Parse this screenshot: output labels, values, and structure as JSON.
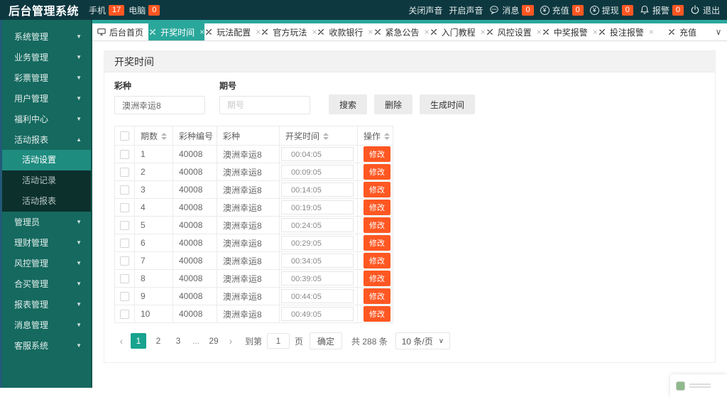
{
  "topbar": {
    "title": "后台管理系统",
    "mobile": {
      "label": "手机",
      "count": "17"
    },
    "pc": {
      "label": "电脑",
      "count": "0"
    },
    "sound_off_label": "关闭声音",
    "sound_on_label": "开启声音",
    "message": {
      "label": "消息",
      "count": "0"
    },
    "recharge": {
      "label": "充值",
      "count": "0"
    },
    "withdraw": {
      "label": "提现",
      "count": "0"
    },
    "alarm": {
      "label": "报警",
      "count": "0"
    },
    "logout_label": "退出"
  },
  "sidebar": {
    "items": [
      {
        "label": "系统管理",
        "state": "collapsed"
      },
      {
        "label": "业务管理",
        "state": "collapsed"
      },
      {
        "label": "彩票管理",
        "state": "collapsed"
      },
      {
        "label": "用户管理",
        "state": "collapsed"
      },
      {
        "label": "福利中心",
        "state": "collapsed"
      },
      {
        "label": "活动报表",
        "state": "expanded",
        "children": [
          {
            "label": "活动设置",
            "active": true
          },
          {
            "label": "活动记录",
            "active": false
          },
          {
            "label": "活动报表",
            "active": false
          }
        ]
      },
      {
        "label": "管理员",
        "state": "collapsed"
      },
      {
        "label": "理财管理",
        "state": "collapsed"
      },
      {
        "label": "风控管理",
        "state": "collapsed"
      },
      {
        "label": "合买管理",
        "state": "collapsed"
      },
      {
        "label": "报表管理",
        "state": "collapsed"
      },
      {
        "label": "消息管理",
        "state": "collapsed"
      },
      {
        "label": "客服系统",
        "state": "collapsed"
      }
    ]
  },
  "tabs": {
    "home_label": "后台首页",
    "items": [
      {
        "label": "开奖时间",
        "active": true,
        "closable": true
      },
      {
        "label": "玩法配置",
        "active": false,
        "closable": true
      },
      {
        "label": "官方玩法",
        "active": false,
        "closable": true
      },
      {
        "label": "收款银行",
        "active": false,
        "closable": true
      },
      {
        "label": "紧急公告",
        "active": false,
        "closable": true
      },
      {
        "label": "入门教程",
        "active": false,
        "closable": true
      },
      {
        "label": "风控设置",
        "active": false,
        "closable": true
      },
      {
        "label": "中奖报警",
        "active": false,
        "closable": true
      },
      {
        "label": "投注报警",
        "active": false,
        "closable": true
      },
      {
        "label": "充值",
        "active": false,
        "closable": false
      }
    ]
  },
  "panel": {
    "title": "开奖时间",
    "form": {
      "lottery_label": "彩种",
      "lottery_value": "澳洲幸运8",
      "issue_label": "期号",
      "issue_placeholder": "期号",
      "search_label": "搜索",
      "delete_label": "删除",
      "generate_label": "生成时间"
    },
    "table": {
      "headers": [
        {
          "label": "期数",
          "sortable": true
        },
        {
          "label": "彩种编号",
          "sortable": false
        },
        {
          "label": "彩种",
          "sortable": false
        },
        {
          "label": "开奖时间",
          "sortable": true
        },
        {
          "label": "操作",
          "sortable": true
        }
      ],
      "action_label": "修改",
      "rows": [
        {
          "no": "1",
          "code": "40008",
          "lottery": "澳洲幸运8",
          "time": "00:04:05"
        },
        {
          "no": "2",
          "code": "40008",
          "lottery": "澳洲幸运8",
          "time": "00:09:05"
        },
        {
          "no": "3",
          "code": "40008",
          "lottery": "澳洲幸运8",
          "time": "00:14:05"
        },
        {
          "no": "4",
          "code": "40008",
          "lottery": "澳洲幸运8",
          "time": "00:19:05"
        },
        {
          "no": "5",
          "code": "40008",
          "lottery": "澳洲幸运8",
          "time": "00:24:05"
        },
        {
          "no": "6",
          "code": "40008",
          "lottery": "澳洲幸运8",
          "time": "00:29:05"
        },
        {
          "no": "7",
          "code": "40008",
          "lottery": "澳洲幸运8",
          "time": "00:34:05"
        },
        {
          "no": "8",
          "code": "40008",
          "lottery": "澳洲幸运8",
          "time": "00:39:05"
        },
        {
          "no": "9",
          "code": "40008",
          "lottery": "澳洲幸运8",
          "time": "00:44:05"
        },
        {
          "no": "10",
          "code": "40008",
          "lottery": "澳洲幸运8",
          "time": "00:49:05"
        }
      ]
    },
    "pagination": {
      "pages": [
        "1",
        "2",
        "3",
        "...",
        "29"
      ],
      "active_page": "1",
      "goto_label": "到第",
      "goto_value": "1",
      "goto_unit": "页",
      "confirm_label": "确定",
      "total_label": "共 288 条",
      "page_size_label": "10 条/页"
    }
  },
  "icons": {
    "close": "×",
    "collapse_down": "▼",
    "collapse_up": "▲",
    "prev": "‹",
    "next": "›",
    "dropdown": "∨"
  },
  "colors": {
    "accent": "#2aa79b",
    "topbar_bg": "#0e3840",
    "sidebar_bg": "#15695f",
    "submenu_bg": "#0c302c",
    "submenu_active_bg": "#1f8c80",
    "badge_bg": "#ff5722",
    "action_button_bg": "#ff5722",
    "pager_active_bg": "#18a38e"
  }
}
